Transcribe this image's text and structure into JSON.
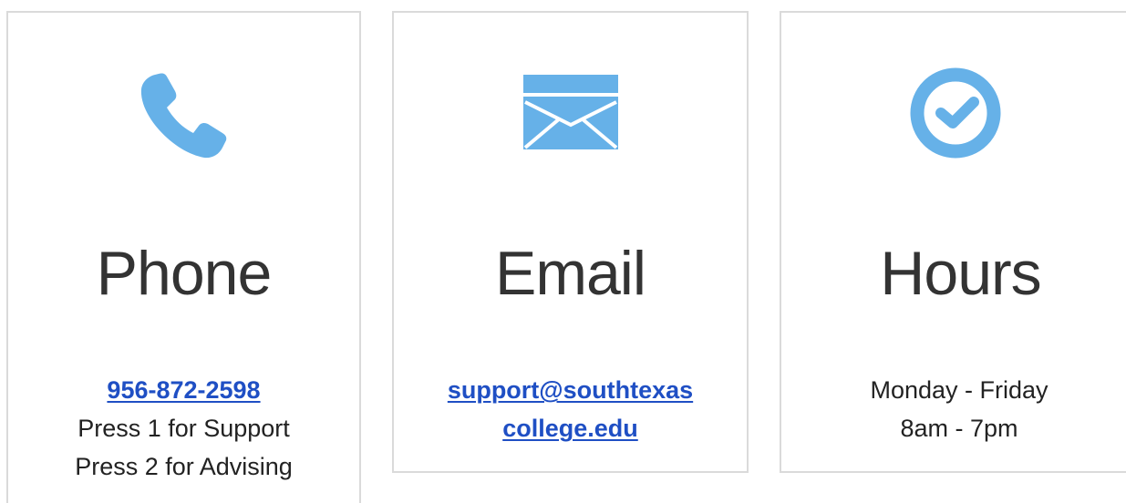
{
  "colors": {
    "icon": "#66b1e8",
    "link": "#1f4fc4",
    "title": "#333333",
    "border": "#dadada"
  },
  "cards": [
    {
      "icon": "phone-icon",
      "title": "Phone",
      "link": "956-872-2598",
      "lines": [
        "Press 1 for Support",
        "Press 2 for Advising"
      ]
    },
    {
      "icon": "envelope-icon",
      "title": "Email",
      "link_lines": [
        "support@southtexas",
        "college.edu"
      ]
    },
    {
      "icon": "clock-icon",
      "title": "Hours",
      "lines": [
        "Monday - Friday",
        "8am - 7pm"
      ]
    }
  ]
}
